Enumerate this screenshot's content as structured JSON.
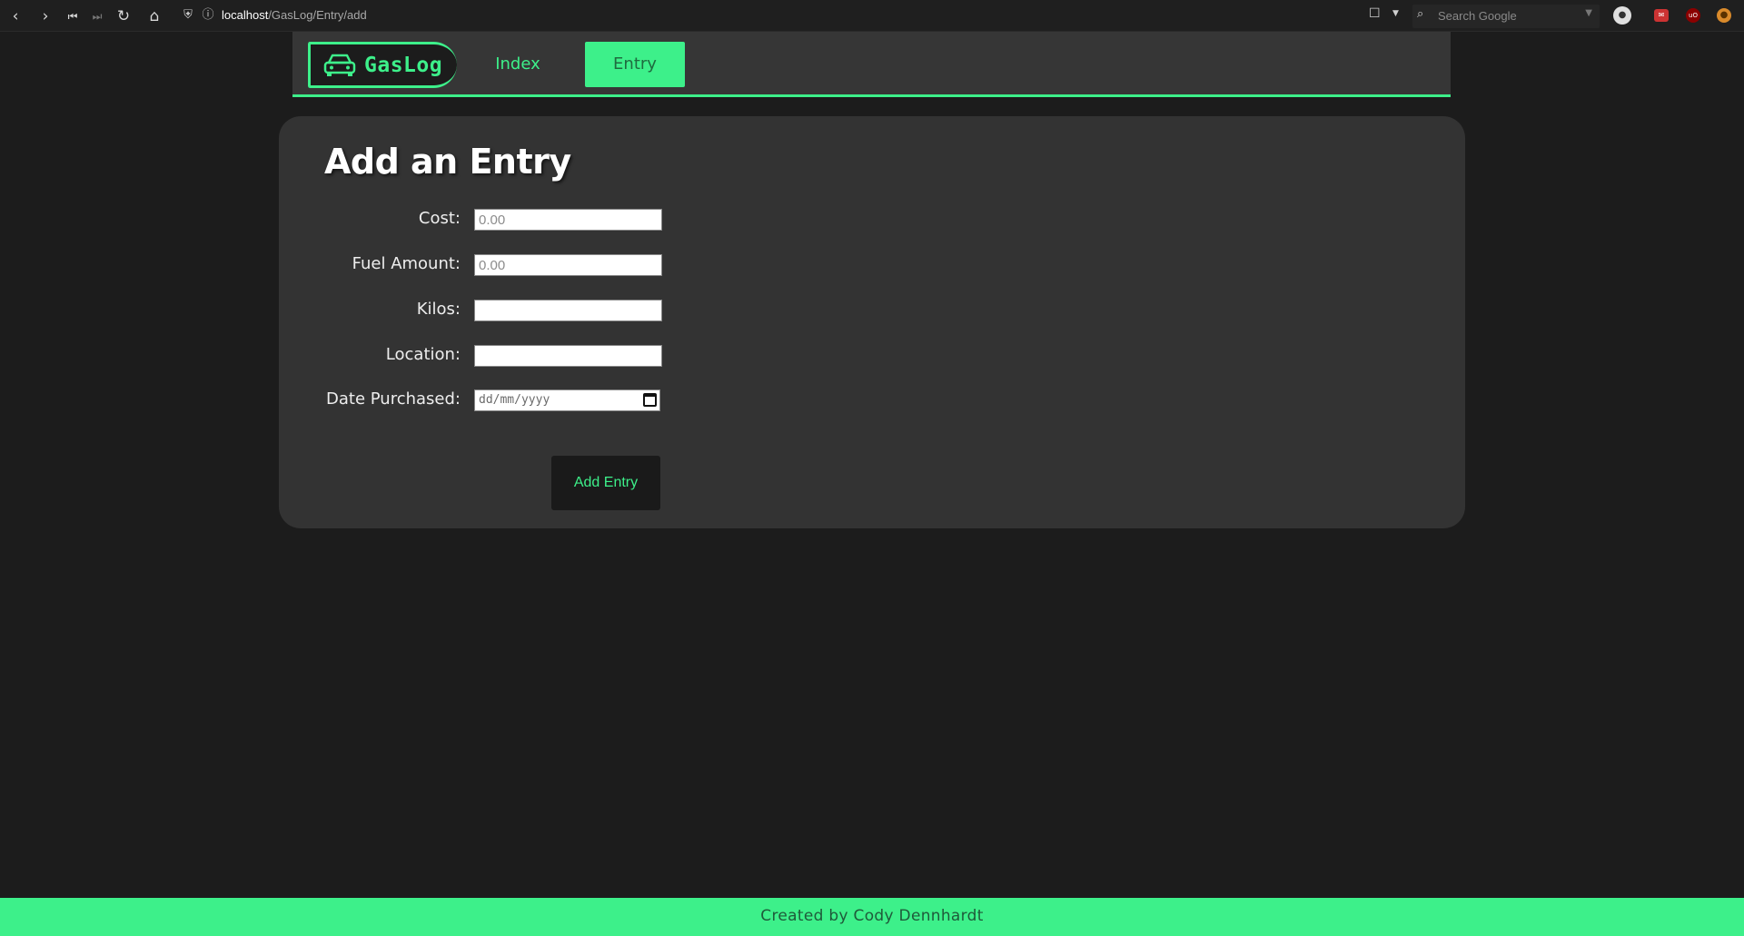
{
  "browser": {
    "url_host": "localhost",
    "url_path": "/GasLog/Entry/add",
    "search_placeholder": "Search Google"
  },
  "nav": {
    "brand": "GasLog",
    "links": [
      {
        "label": "Index"
      },
      {
        "label": "Entry",
        "active": true
      }
    ]
  },
  "form": {
    "title": "Add an Entry",
    "fields": [
      {
        "label": "Cost:",
        "placeholder": "0.00",
        "value": ""
      },
      {
        "label": "Fuel Amount:",
        "placeholder": "0.00",
        "value": ""
      },
      {
        "label": "Kilos:",
        "placeholder": "",
        "value": ""
      },
      {
        "label": "Location:",
        "placeholder": "",
        "value": ""
      },
      {
        "label": "Date Purchased:",
        "placeholder": "dd/mm/yyyy",
        "value": ""
      }
    ],
    "submit_label": "Add Entry"
  },
  "footer": {
    "text": "Created by Cody Dennhardt"
  },
  "colors": {
    "accent": "#3df08a",
    "background": "#1c1c1c",
    "card": "#333333",
    "nav": "#363636"
  },
  "icons": [
    "back-icon",
    "forward-icon",
    "first-page-icon",
    "last-page-icon",
    "reload-icon",
    "home-icon",
    "shield-icon",
    "info-icon",
    "bookmark-icon",
    "search-icon",
    "account-icon",
    "car-icon",
    "calendar-icon"
  ]
}
